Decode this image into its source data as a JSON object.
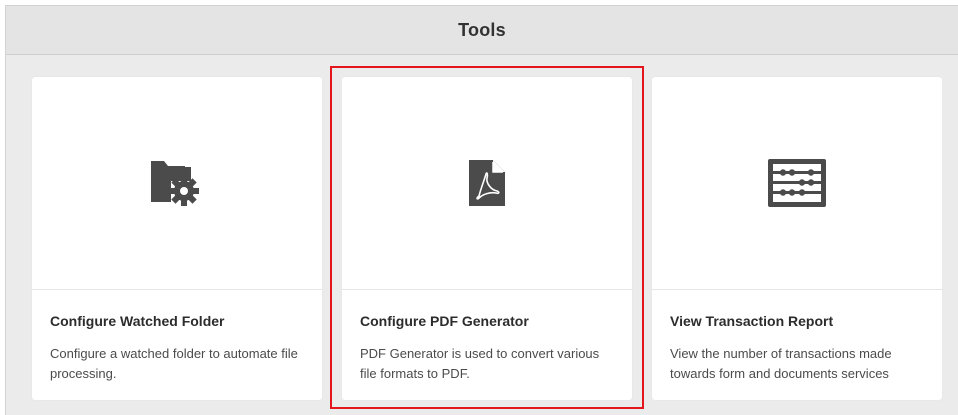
{
  "header": {
    "title": "Tools"
  },
  "cards": [
    {
      "icon": "folder-gear-icon",
      "title": "Configure Watched Folder",
      "description": "Configure a watched folder to automate file processing."
    },
    {
      "icon": "pdf-file-icon",
      "title": "Configure PDF Generator",
      "description": "PDF Generator is used to convert various file formats to PDF."
    },
    {
      "icon": "abacus-icon",
      "title": "View Transaction Report",
      "description": "View the number of transactions made towards form and documents services"
    }
  ],
  "colors": {
    "highlight": "#e3161d",
    "icon": "#4b4b4b",
    "panel_background": "#ebebeb",
    "header_background": "#e4e4e4"
  }
}
